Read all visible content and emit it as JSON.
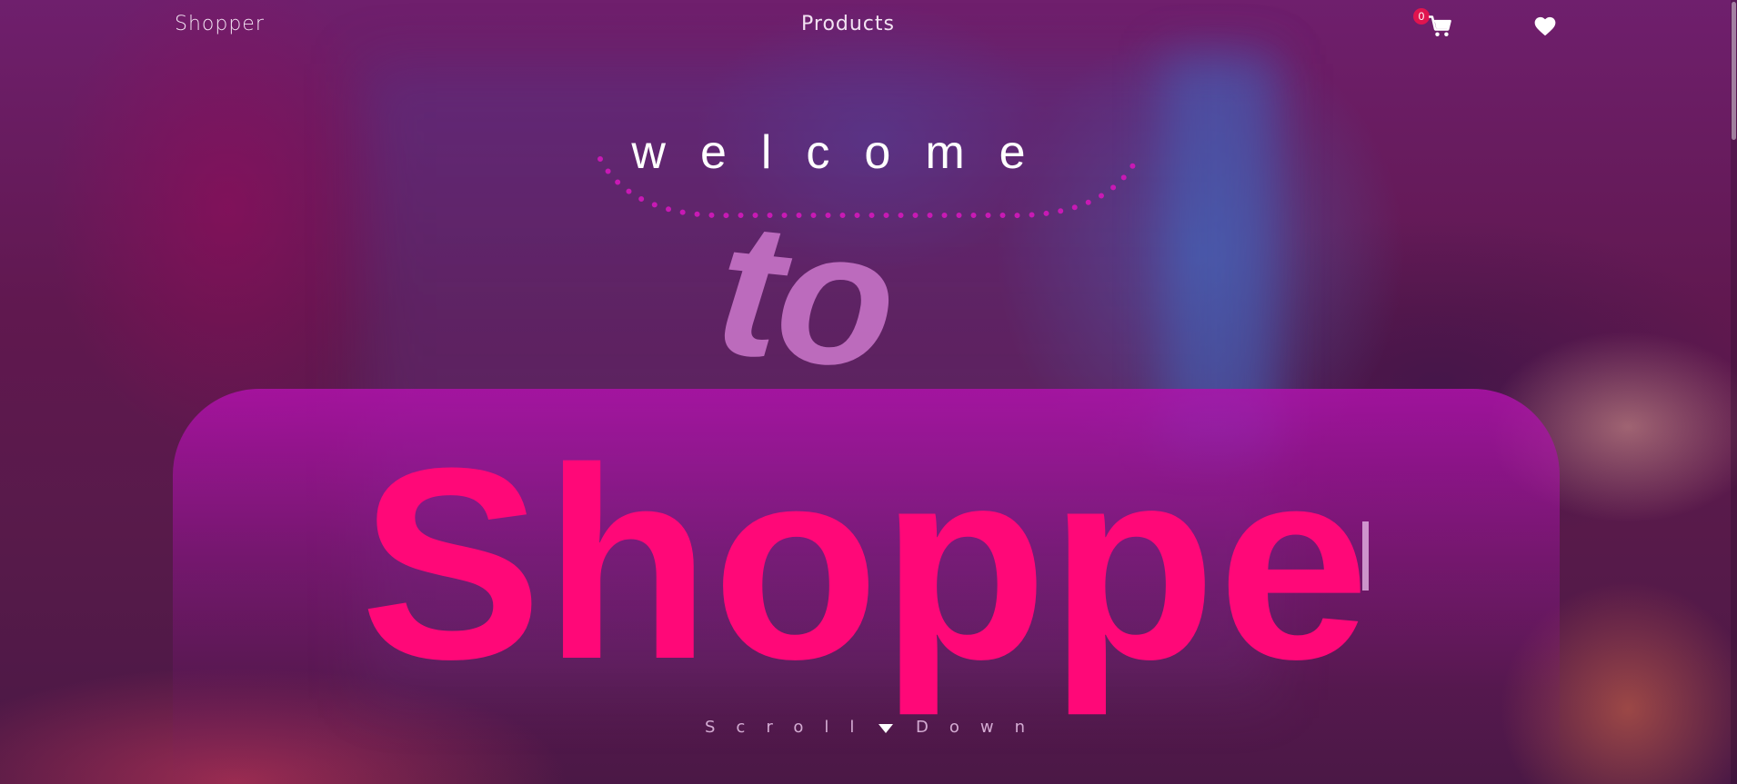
{
  "navbar": {
    "brand": "Shopper",
    "products_link": "Products",
    "cart_count": "0",
    "cart_icon": "shopping-cart-icon",
    "wishlist_icon": "heart-icon"
  },
  "hero": {
    "welcome": "welcome",
    "to": "to",
    "brand_typed": "Shoppe",
    "scroll_left": "Scroll",
    "scroll_right": "Down",
    "scroll_icon": "caret-down-icon"
  },
  "colors": {
    "accent_pink": "#ff0878",
    "panel_magenta": "#af12aa",
    "badge_red": "#e0144f"
  }
}
